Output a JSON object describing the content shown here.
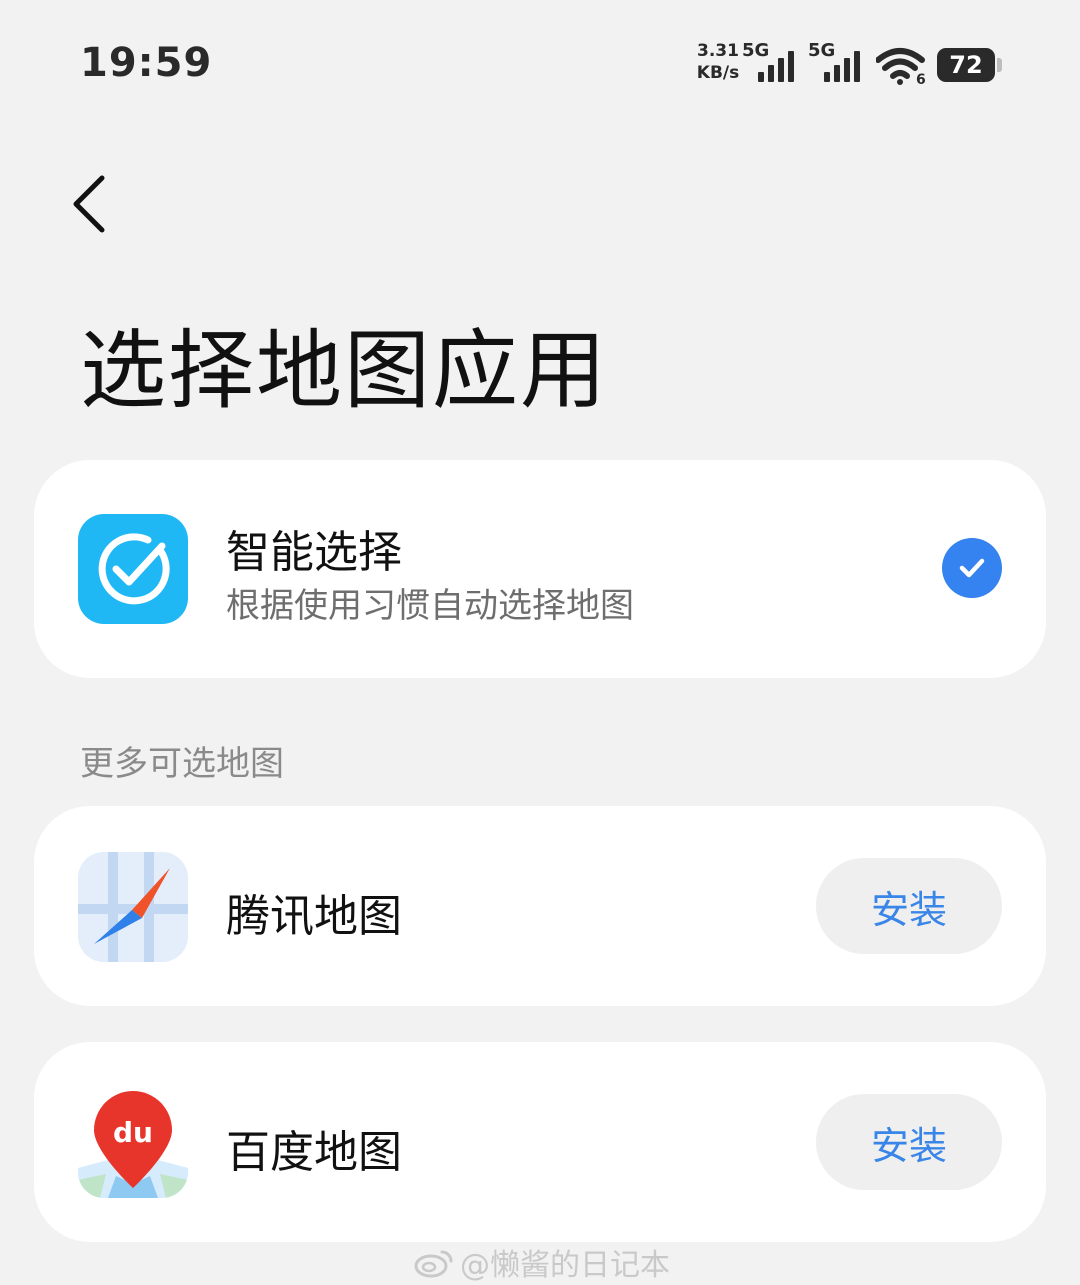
{
  "status_bar": {
    "time": "19:59",
    "net_speed_value": "3.31",
    "net_speed_unit": "KB/s",
    "sim1_label": "5G",
    "sim2_label": "5G",
    "wifi_label": "6",
    "battery": "72"
  },
  "header": {
    "title": "选择地图应用"
  },
  "smart_select": {
    "title": "智能选择",
    "subtitle": "根据使用习惯自动选择地图",
    "selected": true
  },
  "section": {
    "label": "更多可选地图"
  },
  "maps": [
    {
      "name": "腾讯地图",
      "button": "安装",
      "icon": "tencent-map-icon"
    },
    {
      "name": "百度地图",
      "button": "安装",
      "icon": "baidu-map-icon",
      "icon_text": "du"
    }
  ],
  "watermark": {
    "text": "@懒酱的日记本"
  },
  "colors": {
    "background": "#f2f2f2",
    "card": "#ffffff",
    "accent_blue": "#3483f0",
    "install_text": "#3a86e8",
    "smart_icon_bg": "#1fb8f5",
    "baidu_red": "#e8352b"
  }
}
